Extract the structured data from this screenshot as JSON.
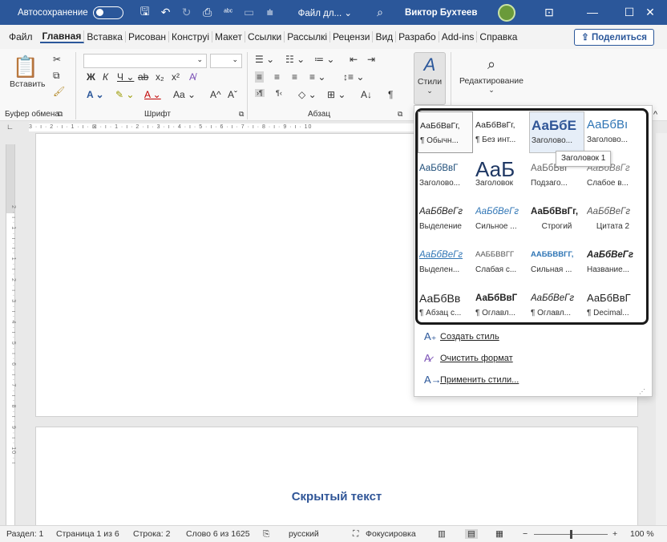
{
  "titlebar": {
    "autosave_label": "Автосохранение",
    "file_name": "Файл дл... ⌄",
    "user_name": "Виктор Бухтеев",
    "colors": {
      "bg": "#2b579a"
    }
  },
  "tabs": [
    "Файл",
    "Главная",
    "Вставка",
    "Рисован",
    "Конструі",
    "Макет",
    "Ссылки",
    "Рассылкі",
    "Рецензи",
    "Вид",
    "Разрабо",
    "Add-ins",
    "Справка"
  ],
  "share_label": "Поделиться",
  "ribbon": {
    "paste_label": "Вставить",
    "groups": {
      "clipboard": "Буфер обмена",
      "font": "Шрифт",
      "paragraph": "Абзац"
    },
    "styles_label": "Стили",
    "editing_label": "Редактирование"
  },
  "ruler_text": "3 · ı · 2 · ı · 1 · ı · ⊠ · ı · 1 · ı · 2 · ı · 3 · ı · 4 · ı · 5 · ı · 6 · ı · 7 · ı · 8 · ı · 9 · ı · 10",
  "vruler_text": "2 · ı · 1 · ı · ı · 1 · ı · 2 · ı · 3 · ı · 4 · ı · 5 · ı · 6 · ı · 7 · ı · 8 · ı · 9 · ı · 10 · ı",
  "document": {
    "hidden_text": "Скрытый текст"
  },
  "styles_gallery": [
    {
      "preview": "АаБбВвГг,",
      "name": "¶ Обычн..."
    },
    {
      "preview": "АаБбВвГг,",
      "name": "¶ Без инт..."
    },
    {
      "preview": "АаБбЕ",
      "name": "Заголово..."
    },
    {
      "preview": "АаБбВı",
      "name": "Заголово..."
    },
    {
      "preview": "АаБбВвГ",
      "name": "Заголово..."
    },
    {
      "preview": "АаБ",
      "name": "Заголовок"
    },
    {
      "preview": "АаБбВвГ",
      "name": "Подзаго..."
    },
    {
      "preview": "АаБбВвГг",
      "name": "Слабое в..."
    },
    {
      "preview": "АаБбВеГг",
      "name": "Выделение"
    },
    {
      "preview": "АаБбВеГг",
      "name": "Сильное ..."
    },
    {
      "preview": "АаБбВвГг,",
      "name": "Строгий"
    },
    {
      "preview": "АаБбВеГг",
      "name": "Цитата 2"
    },
    {
      "preview": "АаБбВеГг",
      "name": "Выделен..."
    },
    {
      "preview": "ААББВВГГ",
      "name": "Слабая с..."
    },
    {
      "preview": "ААББВВГГ,",
      "name": "Сильная ..."
    },
    {
      "preview": "АаБбВеГг",
      "name": "Название..."
    },
    {
      "preview": "АаБбВв",
      "name": "¶ Абзац с..."
    },
    {
      "preview": "АаБбВвГ",
      "name": "¶ Оглавл..."
    },
    {
      "preview": "АаБбВеГг",
      "name": "¶ Оглавл..."
    },
    {
      "preview": "АаБбВвГ",
      "name": "¶ Decimal..."
    }
  ],
  "tooltip": "Заголовок 1",
  "pane_actions": [
    {
      "icon": "create-style-icon",
      "label": "Создать стиль"
    },
    {
      "icon": "clear-format-icon",
      "label": "Очистить формат"
    },
    {
      "icon": "apply-styles-icon",
      "label": "Применить стили..."
    }
  ],
  "statusbar": {
    "section": "Раздел: 1",
    "page": "Страница 1 из 6",
    "line": "Строка: 2",
    "words": "Слово 6 из 1625",
    "language": "русский",
    "focus": "Фокусировка",
    "zoom": "100 %",
    "zoom_fraction": 0.5
  }
}
